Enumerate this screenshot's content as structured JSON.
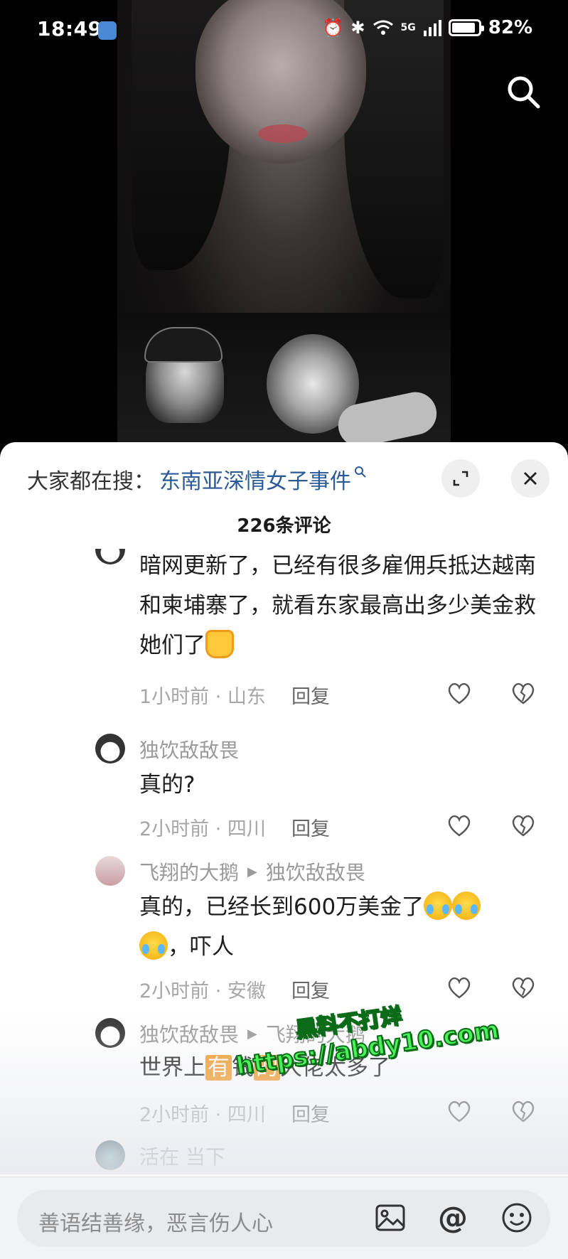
{
  "status_bar": {
    "time": "18:49",
    "battery": "82%",
    "network": "5G"
  },
  "hot_search": {
    "prefix": "大家都在搜：",
    "term": "东南亚深情女子事件"
  },
  "comment_count": "226条评论",
  "comments": [
    {
      "user": "",
      "text_parts": [
        "暗网更新了，已经有很多雇佣兵抵达越南和柬埔寨了，就看东家最高出多少美金救她们了"
      ],
      "time_location": "1小时前 · 山东",
      "reply": "回复"
    },
    {
      "user": "独饮敌敌畏",
      "text": "真的?",
      "time_location": "2小时前 · 四川",
      "reply": "回复"
    },
    {
      "user": "飞翔的大鹅",
      "reply_to": "独饮敌敌畏",
      "text_a": "真的，已经长到600万美金了",
      "text_b": "，吓人",
      "time_location": "2小时前 · 安徽",
      "reply": "回复"
    },
    {
      "user": "独饮敌敌畏",
      "reply_to": "飞翔的大鹅",
      "text_a": "世界上",
      "text_hl1": "有",
      "text_b": "钱",
      "text_hl2": "的",
      "text_c": "大佬太多了",
      "time_location": "2小时前 · 四川",
      "reply": "回复"
    },
    {
      "user": "活在 当下"
    }
  ],
  "watermark": {
    "line1": "黑料不打烊",
    "line2": "https://abdy10.com"
  },
  "input": {
    "placeholder": "善语结善缘，恶言伤人心",
    "at_symbol": "@"
  },
  "colors": {
    "link": "#2c5a96",
    "muted": "#a6a6a6",
    "watermark": "#4cf05a"
  }
}
